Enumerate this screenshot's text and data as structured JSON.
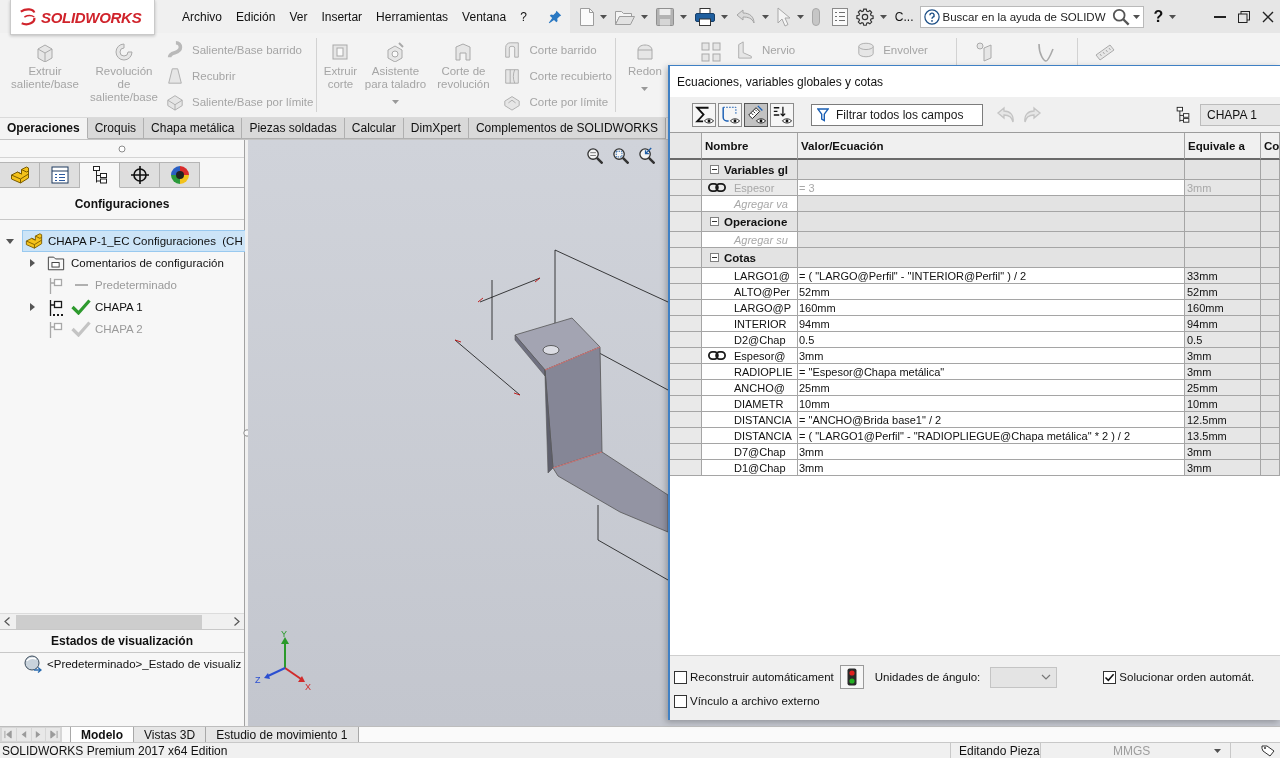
{
  "app": {
    "logo": "SOLIDWORKS",
    "menu": [
      "Archivo",
      "Edición",
      "Ver",
      "Insertar",
      "Herramientas",
      "Ventana",
      "?"
    ],
    "toolbar_overflow": "C...",
    "search": {
      "placeholder": "Buscar en la ayuda de SOLIDW"
    },
    "help": "?"
  },
  "ribbon": {
    "groups": [
      {
        "commands": [
          {
            "kind": "large",
            "label": "Extruir saliente/base",
            "disabled": true
          },
          {
            "kind": "large",
            "label": "Revolución de saliente/base",
            "disabled": true
          },
          {
            "kind": "stack",
            "items": [
              {
                "label": "Saliente/Base barrido",
                "disabled": true
              },
              {
                "label": "Recubrir",
                "disabled": true
              },
              {
                "label": "Saliente/Base por límite",
                "disabled": true
              }
            ]
          }
        ]
      },
      {
        "commands": [
          {
            "kind": "large",
            "label": "Extruir corte",
            "disabled": true
          },
          {
            "kind": "large",
            "label": "Asistente para taladro",
            "disabled": true,
            "dropdown": true
          },
          {
            "kind": "large",
            "label": "Corte de revolución",
            "disabled": true
          },
          {
            "kind": "stack",
            "items": [
              {
                "label": "Corte barrido",
                "disabled": true
              },
              {
                "label": "Corte recubierto",
                "disabled": true
              },
              {
                "label": "Corte por límite",
                "disabled": true
              }
            ]
          }
        ]
      },
      {
        "commands": [
          {
            "kind": "large",
            "label": "Redon",
            "disabled": true,
            "dropdown": true
          },
          {
            "kind": "large",
            "disabled": true
          },
          {
            "kind": "stack",
            "items": [
              {
                "label": "Nervio",
                "disabled": true
              }
            ]
          },
          {
            "kind": "stack",
            "items": [
              {
                "label": "Envolver",
                "disabled": true
              }
            ]
          }
        ]
      },
      {
        "commands": [
          {
            "kind": "large",
            "disabled": true
          },
          {
            "kind": "large",
            "disabled": true
          }
        ]
      },
      {
        "commands": [
          {
            "kind": "large",
            "disabled": true
          }
        ]
      }
    ]
  },
  "command_tabs": [
    {
      "label": "Operaciones",
      "selected": true
    },
    {
      "label": "Croquis",
      "selected": false
    },
    {
      "label": "Chapa metálica",
      "selected": false
    },
    {
      "label": "Piezas soldadas",
      "selected": false
    },
    {
      "label": "Calcular",
      "selected": false
    },
    {
      "label": "DimXpert",
      "selected": false
    },
    {
      "label": "Complementos de SOLIDWORKS",
      "selected": false
    }
  ],
  "feature_manager": {
    "tabs": [
      {
        "selected": false
      },
      {
        "selected": false
      },
      {
        "selected": true
      },
      {
        "selected": false
      },
      {
        "selected": false
      }
    ],
    "title": "Configuraciones",
    "tree": [
      {
        "kind": "part",
        "label": "CHAPA P-1_EC Configuraciones  (CH",
        "expandable": true,
        "expanded": true,
        "selected": true,
        "children": [
          {
            "kind": "folder",
            "label": "Comentarios de configuración",
            "expandable": true,
            "expanded": false,
            "selected": false
          },
          {
            "kind": "config",
            "label": "Predeterminado",
            "expandable": false,
            "selected": false,
            "active": false,
            "checked": false
          },
          {
            "kind": "config",
            "label": "CHAPA 1",
            "expandable": true,
            "expanded": false,
            "selected": false,
            "active": true,
            "checked": true
          },
          {
            "kind": "config",
            "label": "CHAPA 2",
            "expandable": false,
            "selected": false,
            "active": false,
            "checked": true
          }
        ]
      }
    ],
    "display_states": {
      "title": "Estados de visualización",
      "items": [
        {
          "label": "<Predeterminado>_Estado de visualiz",
          "selected": false
        }
      ]
    }
  },
  "viewport": {
    "triad": {
      "x": "X",
      "y": "Y",
      "z": "Z"
    }
  },
  "equations": {
    "title": "Ecuaciones, variables globales y cotas",
    "views": [
      {
        "selected": false
      },
      {
        "selected": false
      },
      {
        "selected": true
      },
      {
        "selected": false
      }
    ],
    "filter": {
      "placeholder": "Filtrar todos los campos"
    },
    "undo": {
      "disabled": true
    },
    "redo": {
      "disabled": true
    },
    "configuration": "CHAPA 1",
    "columns": [
      "Nombre",
      "Valor/Ecuación",
      "Equivale a",
      "Co"
    ],
    "rows": [
      {
        "kind": "group",
        "name": "Variables gl",
        "expanded": true
      },
      {
        "kind": "equation",
        "name": "Espesor",
        "value": "= 3",
        "result": "3mm",
        "linked": true,
        "disabled": true
      },
      {
        "kind": "add",
        "name": "Agregar va"
      },
      {
        "kind": "group",
        "name": "Operacione",
        "expanded": true
      },
      {
        "kind": "add",
        "name": "Agregar su"
      },
      {
        "kind": "group",
        "name": "Cotas",
        "expanded": true
      },
      {
        "kind": "equation",
        "name": "LARGO1@",
        "value": "= ( \"LARGO@Perfil\" - \"INTERIOR@Perfil\" ) / 2",
        "result": "33mm",
        "linked": false,
        "disabled": false
      },
      {
        "kind": "equation",
        "name": "ALTO@Per",
        "value": "52mm",
        "result": "52mm",
        "linked": false,
        "disabled": false
      },
      {
        "kind": "equation",
        "name": "LARGO@P",
        "value": "160mm",
        "result": "160mm",
        "linked": false,
        "disabled": false
      },
      {
        "kind": "equation",
        "name": "INTERIOR",
        "value": "94mm",
        "result": "94mm",
        "linked": false,
        "disabled": false
      },
      {
        "kind": "equation",
        "name": "D2@Chap",
        "value": "0.5",
        "result": "0.5",
        "linked": false,
        "disabled": false
      },
      {
        "kind": "equation",
        "name": "Espesor@",
        "value": "3mm",
        "result": "3mm",
        "linked": true,
        "disabled": false
      },
      {
        "kind": "equation",
        "name": "RADIOPLIE",
        "value": "= \"Espesor@Chapa metálica\"",
        "result": "3mm",
        "linked": false,
        "disabled": false
      },
      {
        "kind": "equation",
        "name": "ANCHO@",
        "value": "25mm",
        "result": "25mm",
        "linked": false,
        "disabled": false
      },
      {
        "kind": "equation",
        "name": "DIAMETR",
        "value": "10mm",
        "result": "10mm",
        "linked": false,
        "disabled": false
      },
      {
        "kind": "equation",
        "name": "DISTANCIA",
        "value": "= \"ANCHO@Brida base1\" / 2",
        "result": "12.5mm",
        "linked": false,
        "disabled": false
      },
      {
        "kind": "equation",
        "name": "DISTANCIA",
        "value": "= ( \"LARGO1@Perfil\" - \"RADIOPLIEGUE@Chapa metálica\" * 2 ) / 2",
        "result": "13.5mm",
        "linked": false,
        "disabled": false
      },
      {
        "kind": "equation",
        "name": "D7@Chap",
        "value": "3mm",
        "result": "3mm",
        "linked": false,
        "disabled": false
      },
      {
        "kind": "equation",
        "name": "D1@Chap",
        "value": "3mm",
        "result": "3mm",
        "linked": false,
        "disabled": false
      }
    ],
    "auto_rebuild": {
      "label": "Reconstruir automáticament",
      "checked": false
    },
    "angle_units": {
      "label": "Unidades de ángulo:",
      "disabled": true
    },
    "auto_solve_order": {
      "label": "Solucionar orden automát.",
      "checked": true
    },
    "external_link": {
      "label": "Vínculo a archivo externo",
      "checked": false
    }
  },
  "sheet_tabs": [
    {
      "label": "Modelo",
      "selected": true
    },
    {
      "label": "Vistas 3D",
      "selected": false
    },
    {
      "label": "Estudio de movimiento 1",
      "selected": false
    }
  ],
  "status_bar": {
    "product": "SOLIDWORKS Premium 2017 x64 Edition",
    "mode": "Editando Pieza",
    "units": {
      "label": "MMGS",
      "disabled": true
    }
  }
}
